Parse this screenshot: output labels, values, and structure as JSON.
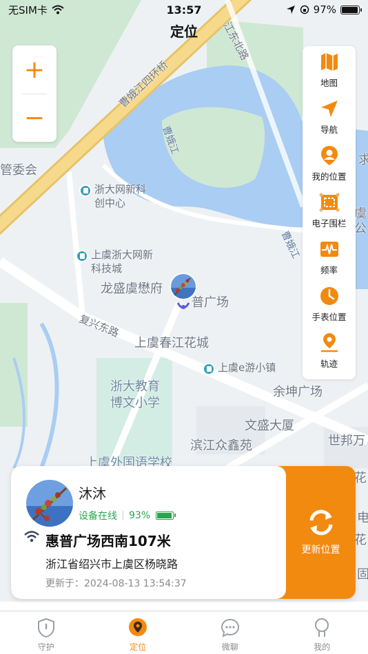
{
  "status_bar": {
    "carrier": "无SIM卡",
    "time": "13:57",
    "battery": "97%",
    "battery_level": 0.97
  },
  "header": {
    "title": "定位"
  },
  "map": {
    "labels": {
      "bridge": "曹娥江四环桥",
      "jiangdong_road": "江东北路",
      "caoe_river_1": "曹娥江",
      "caoe_river_2": "曹娥江",
      "committee": "管委会",
      "zheda_center": "浙大网新科创中心",
      "shangyu_zheda": "上虞浙大网新科技城",
      "longsheng": "龙盛虞懋府",
      "square": "普广场",
      "fuxing_road": "复兴东路",
      "chunjiang": "上虞春江花城",
      "egame": "上虞e游小镇",
      "yukun": "余坤广场",
      "wensheng": "文盛大厦",
      "zheda_school": "浙大教育博文小学",
      "binjiang": "滨江众鑫苑",
      "shibang": "世邦万",
      "foreign_school": "上虞外国语学校",
      "edge_1": "求",
      "edge_2": "虞公",
      "edge_3": "花",
      "edge_4": "电",
      "edge_5": "花",
      "edge_6": "固"
    }
  },
  "zoom": {
    "in": "+",
    "out": "−"
  },
  "toolbar": [
    {
      "id": "map",
      "label": "地图",
      "icon": "map-icon"
    },
    {
      "id": "navigate",
      "label": "导航",
      "icon": "navigation-icon"
    },
    {
      "id": "my_location",
      "label": "我的位置",
      "icon": "person-location-icon"
    },
    {
      "id": "fence",
      "label": "电子围栏",
      "icon": "fence-icon"
    },
    {
      "id": "frequency",
      "label": "频率",
      "icon": "frequency-icon"
    },
    {
      "id": "watch_location",
      "label": "手表位置",
      "icon": "watch-location-icon"
    },
    {
      "id": "track",
      "label": "轨迹",
      "icon": "track-icon"
    }
  ],
  "card": {
    "name": "沐沐",
    "status": "设备在线",
    "battery": "93%",
    "battery_level": 0.93,
    "place": "惠普广场西南107米",
    "address": "浙江省绍兴市上虞区杨晓路",
    "updated": "更新于：2024-08-13 13:54:37",
    "refresh_label": "更新位置"
  },
  "tabs": [
    {
      "id": "guard",
      "label": "守护",
      "active": false
    },
    {
      "id": "locate",
      "label": "定位",
      "active": true
    },
    {
      "id": "chat",
      "label": "微聊",
      "active": false
    },
    {
      "id": "mine",
      "label": "我的",
      "active": false
    }
  ],
  "colors": {
    "accent": "#f28a10",
    "online": "#2aa54d",
    "water": "#a9cdf3",
    "green": "#cde9d0",
    "road_yellow": "#f6d27a"
  }
}
